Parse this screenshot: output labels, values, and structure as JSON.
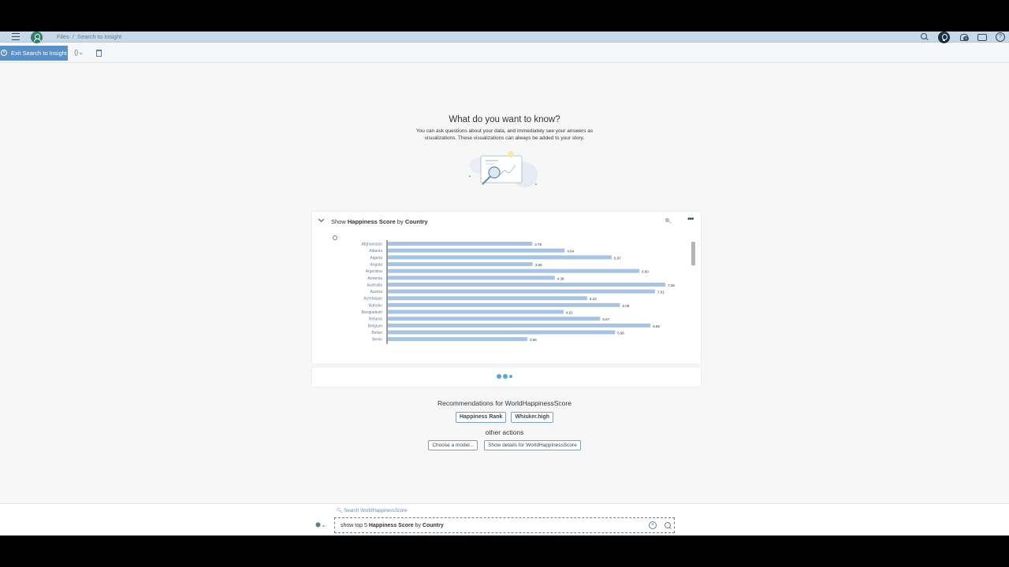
{
  "breadcrumb": {
    "root": "Files",
    "separator": "/",
    "current": "Search to Insight"
  },
  "shell": {
    "notification_count": "8"
  },
  "toolbar": {
    "exit_label": "Exit Search to Insight",
    "code_label": "{}",
    "chevron": "⌄"
  },
  "hero": {
    "title": "What do you want to know?",
    "subtitle": "You can ask questions about your data, and immediately see your answers as visualizations. These visualizations can always be added to your story."
  },
  "card": {
    "title_prefix": "Show ",
    "title_measure": "Happiness Score",
    "title_by": " by ",
    "title_dimension": "Country"
  },
  "chart_data": {
    "type": "bar",
    "orientation": "horizontal",
    "categories": [
      "Afghanistan",
      "Albania",
      "Algeria",
      "Angola",
      "Argentina",
      "Armenia",
      "Australia",
      "Austria",
      "Azerbaijan",
      "Bahrain",
      "Bangladesh",
      "Belarus",
      "Belgium",
      "Belize",
      "Benin"
    ],
    "values": [
      3.79,
      4.64,
      5.87,
      3.8,
      6.6,
      4.38,
      7.28,
      7.01,
      5.23,
      6.09,
      4.61,
      5.57,
      6.89,
      5.96,
      3.66
    ],
    "labels": [
      "3.79",
      "4.64",
      "5.87",
      "3.80",
      "6.60",
      "4.38",
      "7.28",
      "7.01",
      "5.23",
      "6.09",
      "4.61",
      "5.57",
      "6.89",
      "5.96",
      "3.66"
    ],
    "color": "#a8c4e0",
    "xlim": [
      0,
      7.28
    ]
  },
  "recommendations": {
    "title": "Recommendations for WorldHappinessScore",
    "chips": [
      "Happiness Rank",
      "Whisker.high"
    ],
    "other_title": "other actions",
    "actions": [
      "Choose a model...",
      "Show details for WorldHappinessScore"
    ]
  },
  "search": {
    "hint": "Search WorldHappinessScore",
    "query_prefix": "show top 5 ",
    "query_measure": "Happiness Score",
    "query_by": " by ",
    "query_dimension": "Country",
    "clear": "×"
  },
  "colors": {
    "shellbar": "#c6d9e8",
    "accent": "#5c90c4",
    "bar": "#a8c4e0"
  }
}
